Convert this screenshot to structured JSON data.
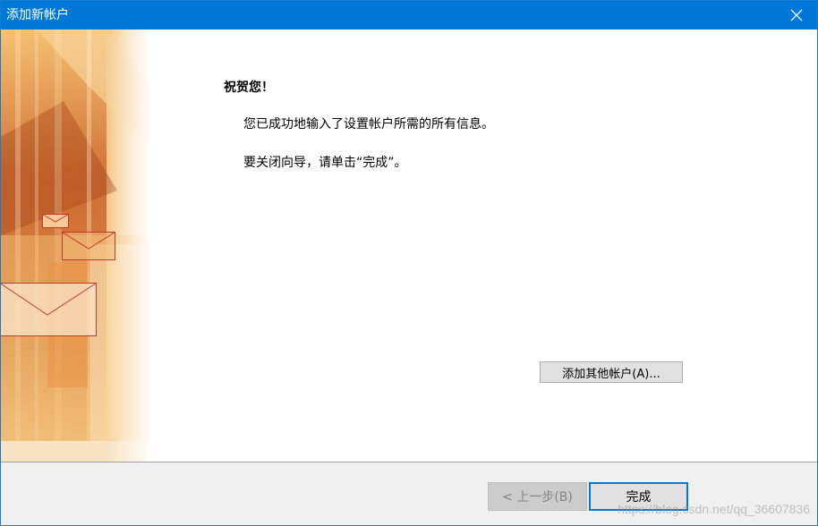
{
  "window": {
    "title": "添加新帐户"
  },
  "icons": {
    "close": "close-icon",
    "envelope": "envelope-icon"
  },
  "colors": {
    "titlebar": "#0078d7",
    "focus_border": "#0078d7",
    "art_orange": "#e28a2c",
    "art_brown": "#b3501d"
  },
  "main": {
    "heading": "祝贺您！",
    "line1": "您已成功地输入了设置帐户所需的所有信息。",
    "line2": "要关闭向导，请单击“完成”。",
    "add_other_label": "添加其他帐户(A)..."
  },
  "footer": {
    "back_label": "< 上一步(B)",
    "finish_label": "完成",
    "watermark": "https://blog.csdn.net/qq_36607836"
  }
}
